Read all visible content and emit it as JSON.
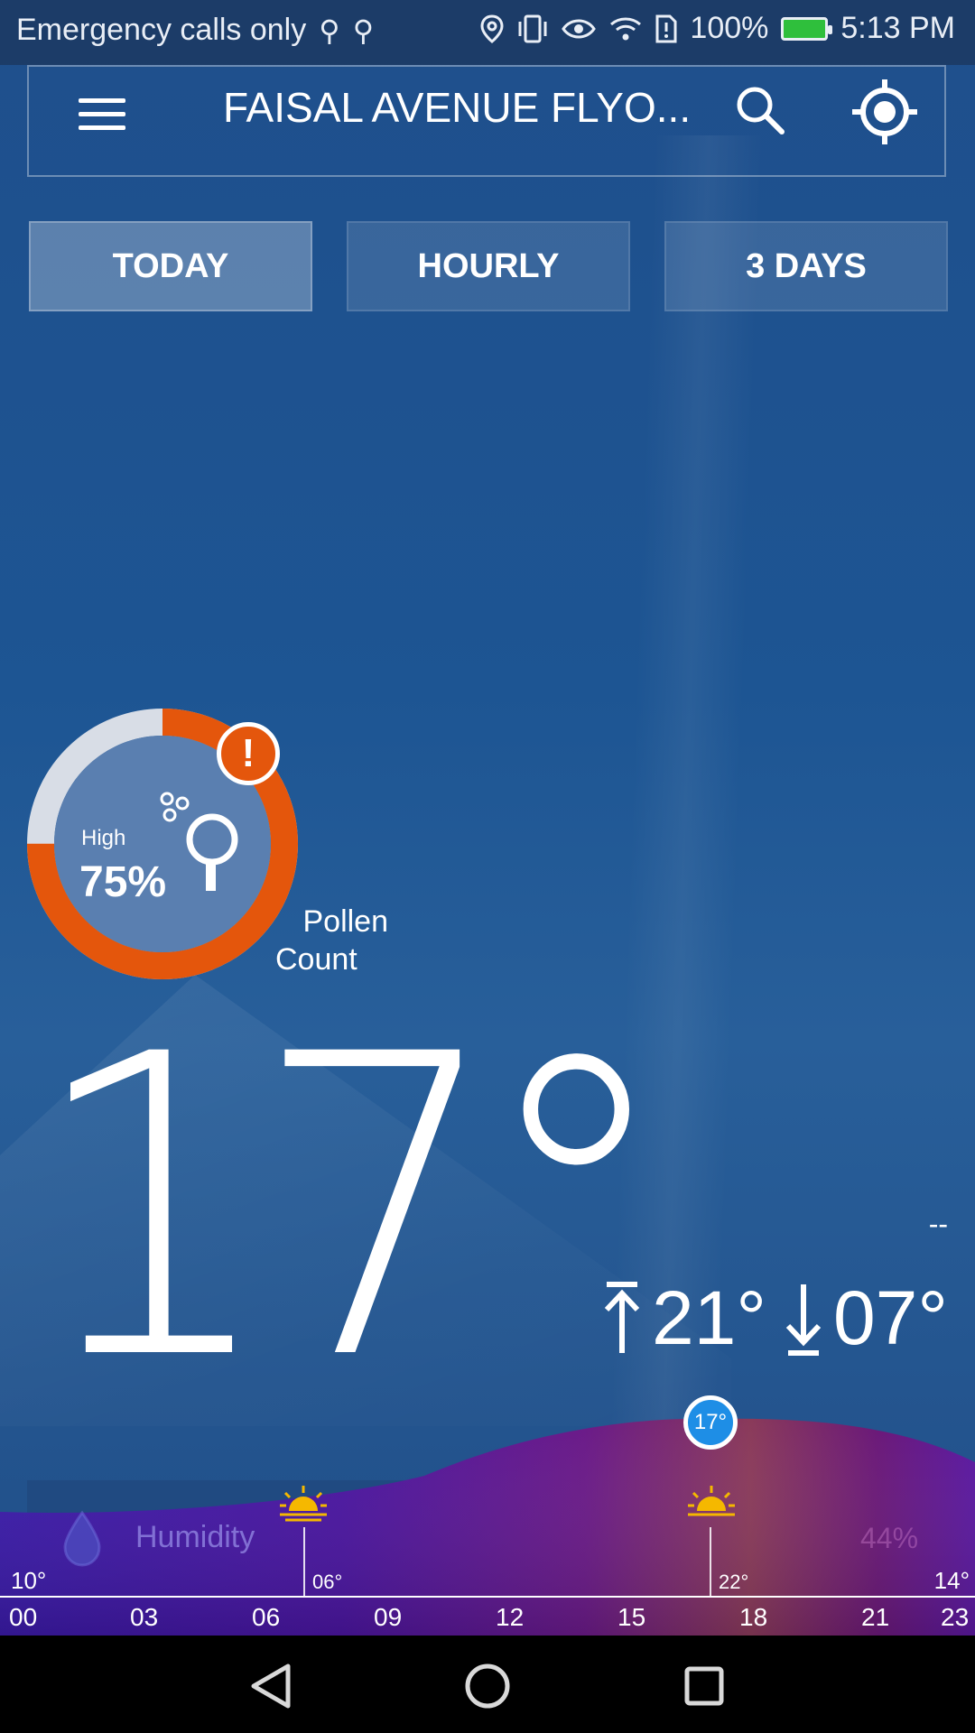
{
  "status_bar": {
    "carrier_text": "Emergency calls only",
    "battery_text": "100%",
    "time": "5:13 PM"
  },
  "app_bar": {
    "title": "FAISAL AVENUE FLYO...",
    "menu_icon": "menu-icon",
    "search_icon": "search-icon",
    "locate_icon": "my-location-icon"
  },
  "tabs": [
    {
      "label": "TODAY",
      "active": true
    },
    {
      "label": "HOURLY",
      "active": false
    },
    {
      "label": "3 DAYS",
      "active": false
    }
  ],
  "pollen": {
    "level_text": "High",
    "percent_text": "75%",
    "percent_value": 75,
    "label_line1": "Pollen",
    "label_line2": "Count",
    "alert_symbol": "!",
    "ring_color": "#e4560c"
  },
  "current": {
    "temperature": "17°",
    "dash": "--",
    "high": "21°",
    "low": "07°"
  },
  "day_chart": {
    "current_marker": "17°",
    "humidity_label": "Humidity",
    "humidity_value": "44%",
    "min_left": "10°",
    "max_right": "14°",
    "sunrise_label": "06°",
    "sunset_label": "22°",
    "hours": [
      "00",
      "03",
      "06",
      "09",
      "12",
      "15",
      "18",
      "21",
      "23"
    ]
  }
}
